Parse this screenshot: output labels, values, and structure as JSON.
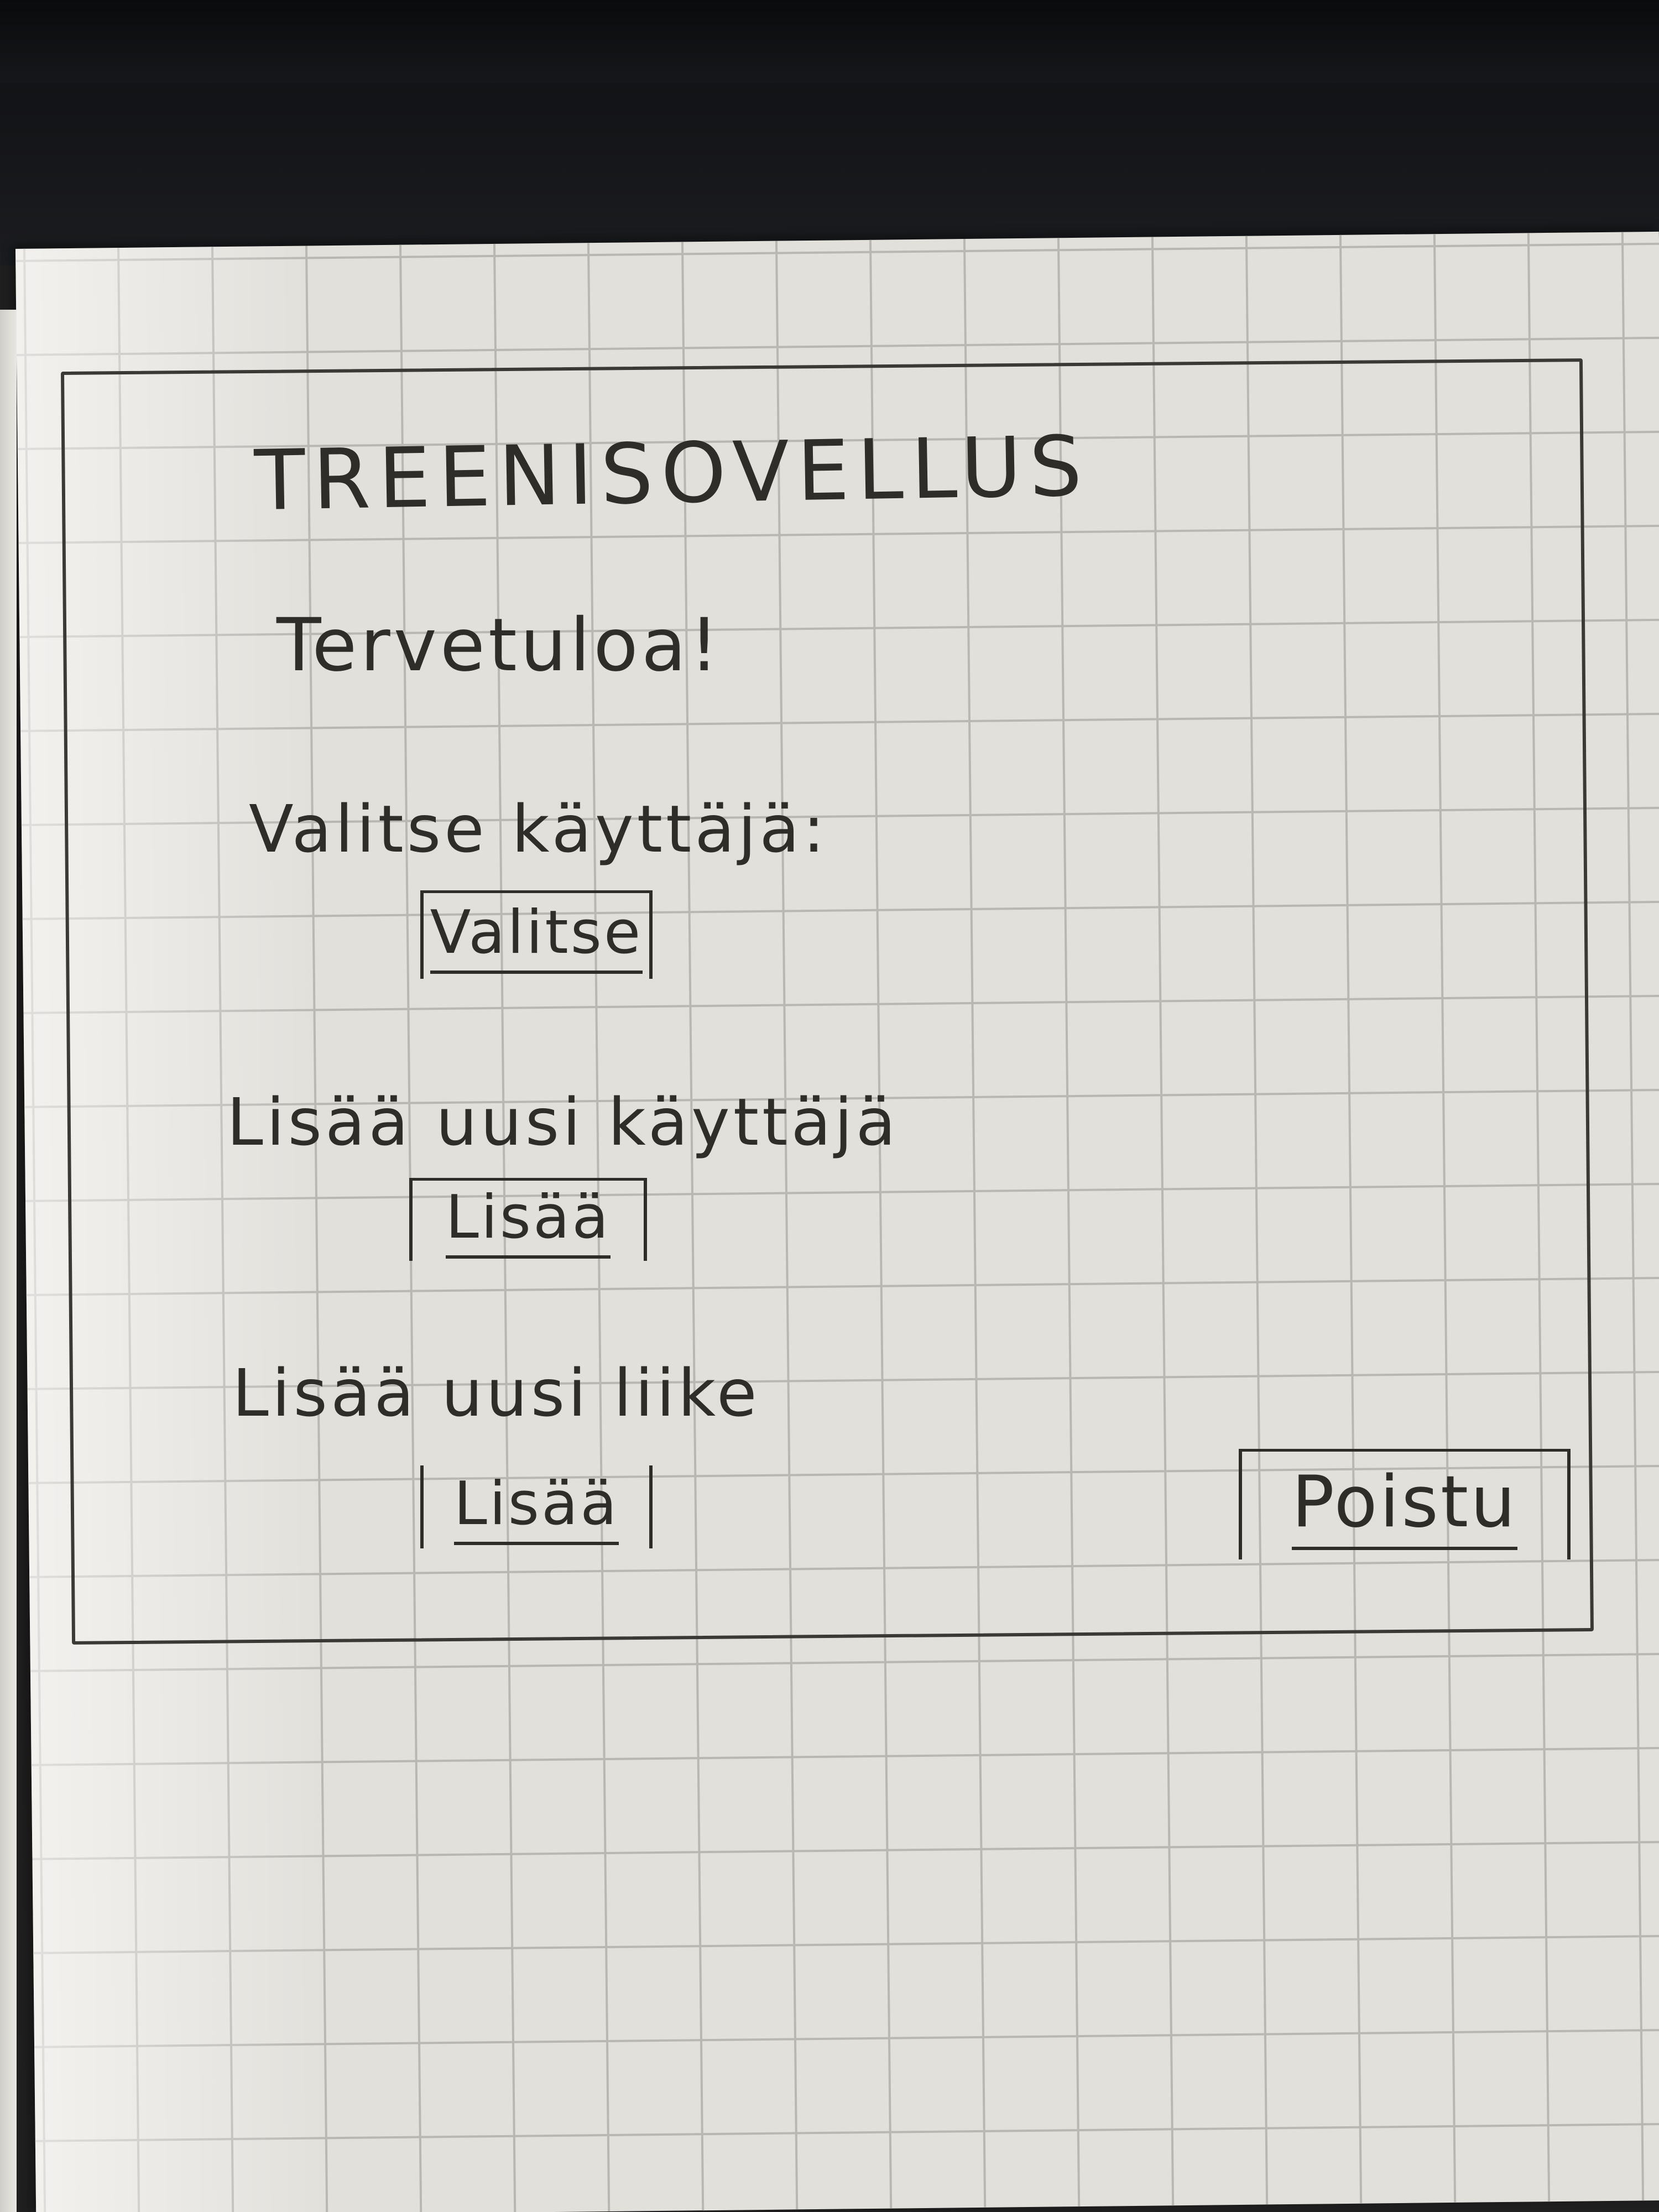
{
  "app": {
    "title": "TREENISOVELLUS",
    "welcome": "Tervetuloa!"
  },
  "select_user": {
    "label": "Valitse käyttäjä:",
    "button": "Valitse"
  },
  "add_user": {
    "label": "Lisää uusi käyttäjä",
    "button": "Lisää"
  },
  "add_move": {
    "label": "Lisää uusi liike",
    "button": "Lisää"
  },
  "exit": {
    "button": "Poistu"
  },
  "colors": {
    "ink": "#2f2d2a",
    "paper": "#e2e0db",
    "grid": "#b9b7b2",
    "desk": "#1b1c1f"
  }
}
